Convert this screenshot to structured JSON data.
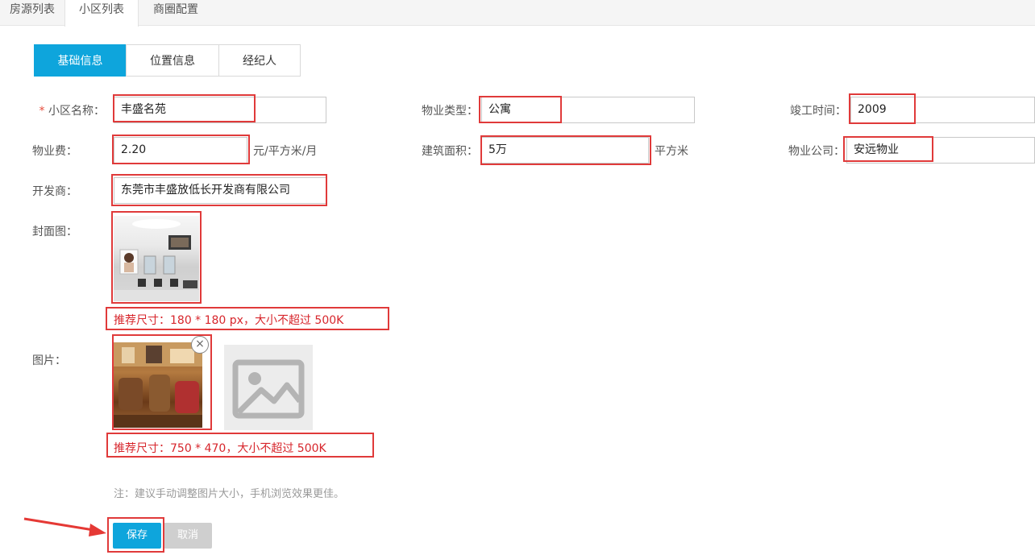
{
  "top_tabs": [
    "房源列表",
    "小区列表",
    "商圈配置"
  ],
  "sub_tabs": [
    "基础信息",
    "位置信息",
    "经纪人"
  ],
  "form": {
    "required_mark": "*",
    "community_name": {
      "label": "小区名称：",
      "value": "丰盛名苑"
    },
    "property_type": {
      "label": "物业类型：",
      "value": "公寓"
    },
    "completion_time": {
      "label": "竣工时间：",
      "value": "2009"
    },
    "property_fee": {
      "label": "物业费：",
      "value": "2.20",
      "unit": "元/平方米/月"
    },
    "building_area": {
      "label": "建筑面积：",
      "value": "5万",
      "unit": "平方米"
    },
    "property_company": {
      "label": "物业公司：",
      "value": "安远物业"
    },
    "developer": {
      "label": "开发商：",
      "value": "东莞市丰盛放低长开发商有限公司"
    },
    "cover": {
      "label": "封面图：",
      "hint": "推荐尺寸：180 * 180 px，大小不超过 500K"
    },
    "pictures": {
      "label": "图片：",
      "hint": "推荐尺寸：750 * 470，大小不超过 500K",
      "close": "×"
    },
    "note": "注：建议手动调整图片大小，手机浏览效果更佳。"
  },
  "buttons": {
    "save": "保存",
    "cancel": "取消"
  },
  "colors": {
    "accent": "#0ea5dc",
    "highlight_box": "#e03a3a",
    "hint_text": "#d7262c"
  },
  "icons": {
    "placeholder": "image-placeholder-icon",
    "annotation_arrow": "red-arrow-icon"
  }
}
